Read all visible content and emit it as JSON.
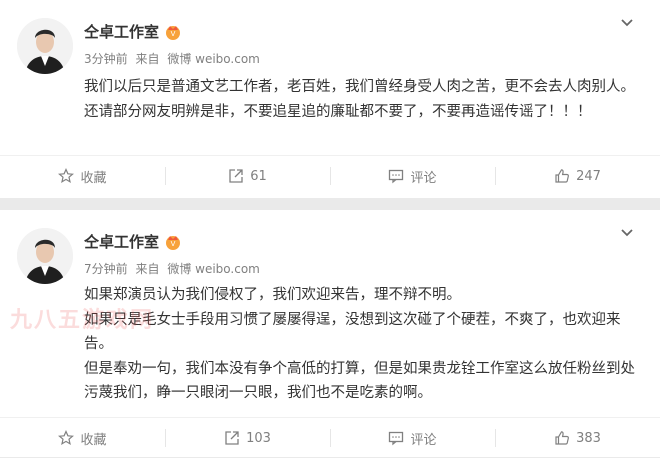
{
  "colors": {
    "background": "#eaeaea",
    "card": "#ffffff",
    "meta": "#808080",
    "text": "#333333",
    "watermark": "#eb3c3c"
  },
  "posts": [
    {
      "author": "仝卓工作室",
      "time": "3分钟前",
      "from_label": "来自",
      "source": "微博 weibo.com",
      "paragraphs": [
        "我们以后只是普通文艺工作者，老百姓，我们曾经身受人肉之苦，更不会去人肉别人。还请部分网友明辨是非，不要追星追的廉耻都不要了，不要再造谣传谣了！！！"
      ],
      "actions": {
        "favorite": "收藏",
        "repost": "61",
        "comment": "评论",
        "like": "247"
      }
    },
    {
      "author": "仝卓工作室",
      "time": "7分钟前",
      "from_label": "来自",
      "source": "微博 weibo.com",
      "paragraphs": [
        "如果郑演员认为我们侵权了，我们欢迎来告，理不辩不明。",
        "如果只是毛女士手段用习惯了屡屡得逞，没想到这次碰了个硬茬，不爽了，也欢迎来告。",
        "但是奉劝一句，我们本没有争个高低的打算，但是如果贵龙铨工作室这么放任粉丝到处污蔑我们，睁一只眼闭一只眼，我们也不是吃素的啊。"
      ],
      "actions": {
        "favorite": "收藏",
        "repost": "103",
        "comment": "评论",
        "like": "383"
      }
    }
  ],
  "watermark": "九八五游戏网"
}
